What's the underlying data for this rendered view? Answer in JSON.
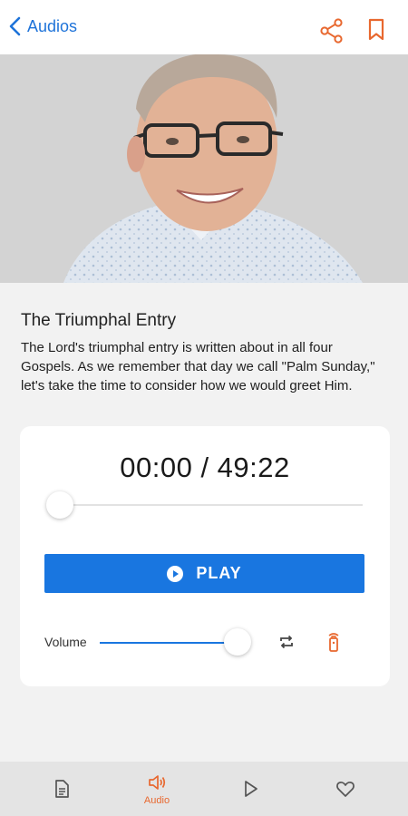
{
  "header": {
    "back_label": "Audios"
  },
  "content": {
    "title": "The Triumphal Entry",
    "description": "The Lord's triumphal entry is written about in all four Gospels. As we remember that day we call \"Palm Sunday,\" let's take the time to consider how we would greet Him."
  },
  "player": {
    "time_display": "00:00 / 49:22",
    "progress": 0,
    "play_label": "PLAY",
    "volume_label": "Volume",
    "volume_level": 1.0
  },
  "tabs": [
    {
      "icon": "document-icon",
      "label": ""
    },
    {
      "icon": "speaker-icon",
      "label": "Audio",
      "active": true
    },
    {
      "icon": "play-icon",
      "label": ""
    },
    {
      "icon": "heart-icon",
      "label": ""
    }
  ],
  "colors": {
    "accent": "#e8682f",
    "primary": "#1976e0",
    "link": "#1e73d9"
  }
}
